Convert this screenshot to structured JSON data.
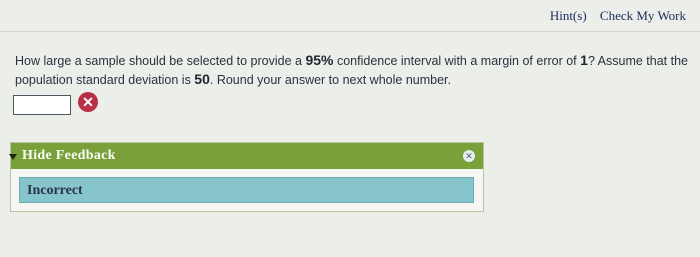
{
  "header": {
    "hint_label": "Hint(s)",
    "check_label": "Check My Work"
  },
  "question": {
    "part1": "How large a sample should be selected to provide a ",
    "confidence": "95%",
    "part2": " confidence interval with a margin of error of ",
    "margin": "1",
    "part3": "? Assume that the population standard deviation is ",
    "sigma": "50",
    "part4": ". Round your answer to next whole number."
  },
  "answer": {
    "value": "",
    "status_icon": "x-circle-icon"
  },
  "feedback": {
    "toggle_label": "Hide Feedback",
    "result": "Incorrect"
  },
  "colors": {
    "header_green": "#7aa03a",
    "result_teal": "#87c5cc",
    "error_red": "#b83046"
  }
}
